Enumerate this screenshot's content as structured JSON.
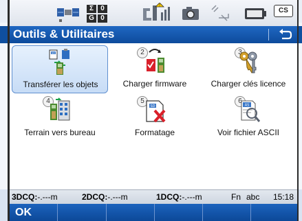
{
  "status": {
    "satellites": {
      "sigma_label": "Σ",
      "sigma_value": "0",
      "g_label": "G",
      "g_value": "0"
    },
    "cs_label": "CS"
  },
  "header": {
    "title": "Outils & Utilitaires"
  },
  "tiles": [
    {
      "number": "",
      "label": "Transférer les objets",
      "icon": "transfer-objects-icon"
    },
    {
      "number": "2",
      "label": "Charger firmware",
      "icon": "load-firmware-icon"
    },
    {
      "number": "3",
      "label": "Charger clés licence",
      "icon": "license-keys-icon"
    },
    {
      "number": "4",
      "label": "Terrain vers bureau",
      "icon": "field-to-office-icon"
    },
    {
      "number": "5",
      "label": "Formatage",
      "icon": "format-icon"
    },
    {
      "number": "6",
      "label": "Voir fichier ASCII",
      "icon": "view-ascii-icon"
    }
  ],
  "infobar": {
    "q3_label": "3DCQ:",
    "q3_value": "-.---m",
    "q2_label": "2DCQ:",
    "q2_value": "-.---m",
    "q1_label": "1DCQ:",
    "q1_value": "-.---m",
    "fn": "Fn",
    "input_mode": "abc",
    "time": "15:18"
  },
  "softkeys": {
    "ok_label": "OK"
  },
  "colors": {
    "title_bar": "#0d4b9c",
    "selected_tile": "#c7dcf6",
    "accent_red": "#d9202a"
  }
}
